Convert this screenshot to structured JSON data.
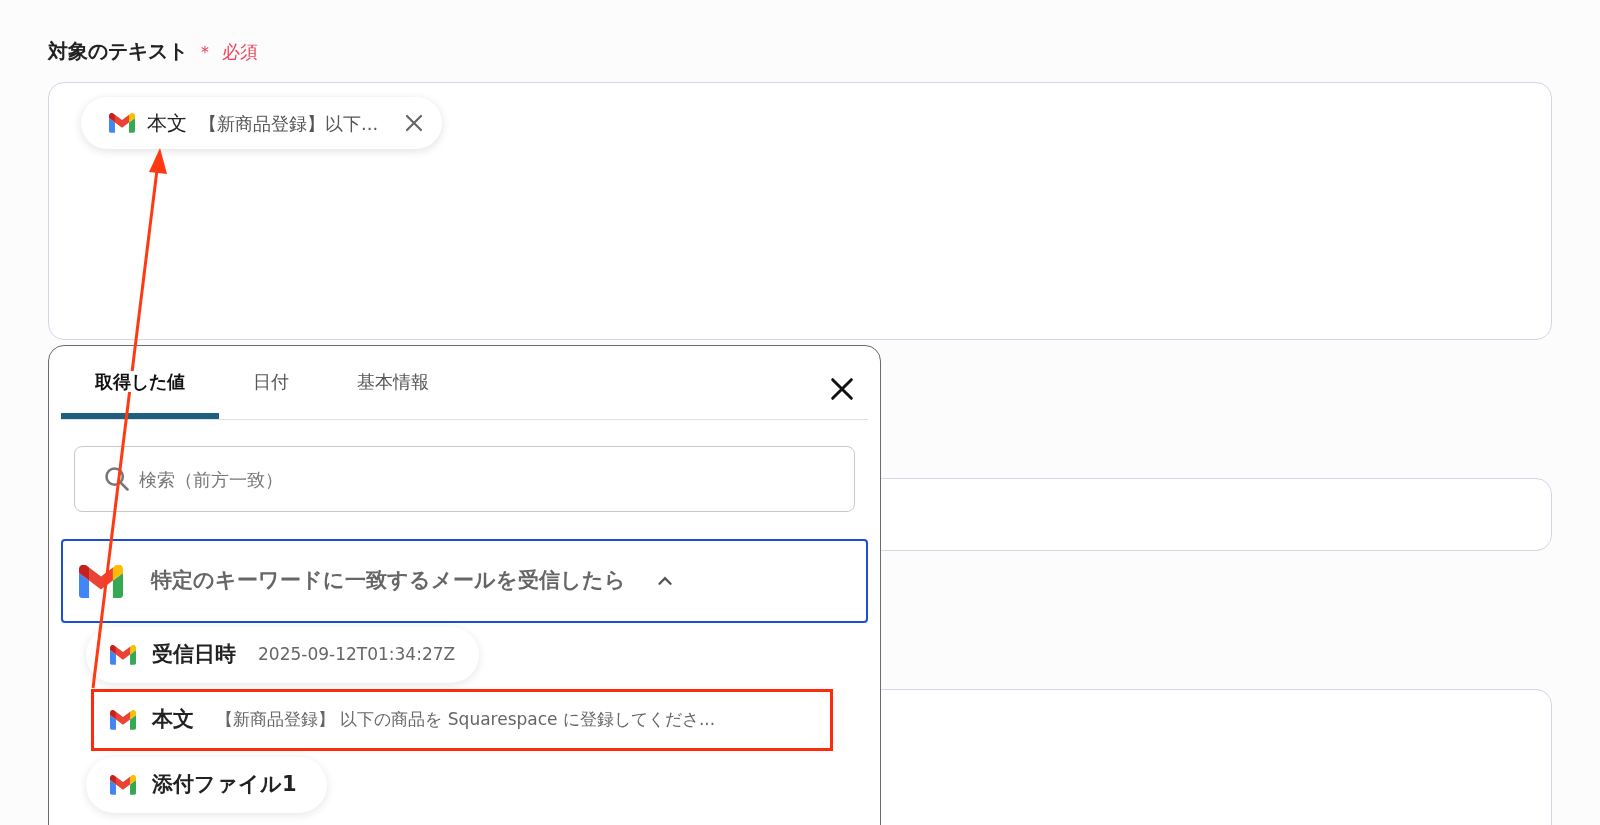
{
  "field": {
    "label": "対象のテキスト",
    "required_mark": "＊",
    "required": "必須",
    "chips": [
      {
        "title": "本文",
        "value": "【新商品登録】以下..."
      }
    ]
  },
  "popup": {
    "tabs": [
      {
        "label": "取得した値",
        "selected": true
      },
      {
        "label": "日付",
        "selected": false
      },
      {
        "label": "基本情報",
        "selected": false
      }
    ],
    "search": {
      "placeholder": "検索（前方一致）"
    },
    "group": {
      "title": "特定のキーワードに一致するメールを受信したら",
      "expanded": true,
      "items": [
        {
          "name": "受信日時",
          "value": "2025-09-12T01:34:27Z",
          "highlighted": false
        },
        {
          "name": "本文",
          "value": "【新商品登録】 以下の商品を Squarespace に登録してくださ...",
          "highlighted": true
        },
        {
          "name": "添付ファイル1",
          "highlighted": false
        }
      ]
    }
  }
}
